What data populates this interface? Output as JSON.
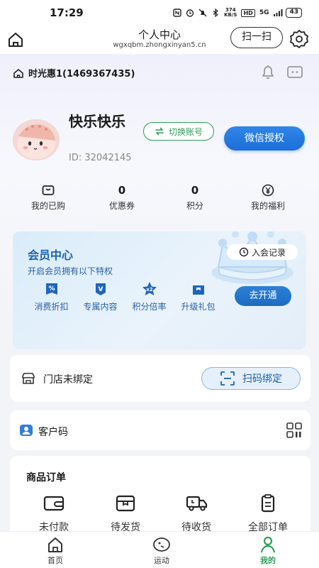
{
  "status": {
    "time": "17:29",
    "net_speed_value": "374",
    "net_speed_unit": "KB/S",
    "hd": "HD",
    "signal_label": "5G",
    "battery": "43"
  },
  "header": {
    "title": "个人中心",
    "url": "wgxqbm.zhongxinyan5.cn",
    "scan_label": "扫一扫"
  },
  "store": {
    "name": "时光惠1(1469367435)"
  },
  "profile": {
    "nickname": "快乐快乐",
    "id_text": "ID: 32042145",
    "switch_label": "切换账号",
    "wechat_label": "微信授权"
  },
  "stats": [
    {
      "label": "我的已购",
      "icon": "bag-icon"
    },
    {
      "value": "0",
      "label": "优惠券"
    },
    {
      "value": "0",
      "label": "积分"
    },
    {
      "label": "我的福利",
      "icon": "yen-icon"
    }
  ],
  "member": {
    "title": "会员中心",
    "subtitle": "开启会员拥有以下特权",
    "record_label": "入会记录",
    "open_label": "去开通",
    "perks": [
      {
        "label": "消费折扣",
        "icon": "discount-icon",
        "icon_text": "%"
      },
      {
        "label": "专属内容",
        "icon": "exclusive-icon",
        "icon_text": "V"
      },
      {
        "label": "积分倍率",
        "icon": "star-icon",
        "icon_text": "x2"
      },
      {
        "label": "升级礼包",
        "icon": "gift-icon",
        "icon_text": ""
      }
    ]
  },
  "store_binding": {
    "label": "门店未绑定",
    "button_label": "扫码绑定"
  },
  "customer_code": {
    "label": "客户码"
  },
  "orders": {
    "title": "商品订单",
    "items": [
      {
        "label": "未付款",
        "icon": "wallet-icon"
      },
      {
        "label": "待发货",
        "icon": "package-icon"
      },
      {
        "label": "待收货",
        "icon": "truck-icon"
      },
      {
        "label": "全部订单",
        "icon": "clipboard-icon"
      }
    ]
  },
  "nav": {
    "items": [
      {
        "label": "首页",
        "icon": "home-icon"
      },
      {
        "label": "运动",
        "icon": "sport-icon"
      },
      {
        "label": "我的",
        "icon": "profile-icon",
        "active": true
      }
    ]
  },
  "colors": {
    "accent_blue": "#1c6fd9",
    "accent_green": "#2f9e5b",
    "member_text": "#1d62b4"
  }
}
